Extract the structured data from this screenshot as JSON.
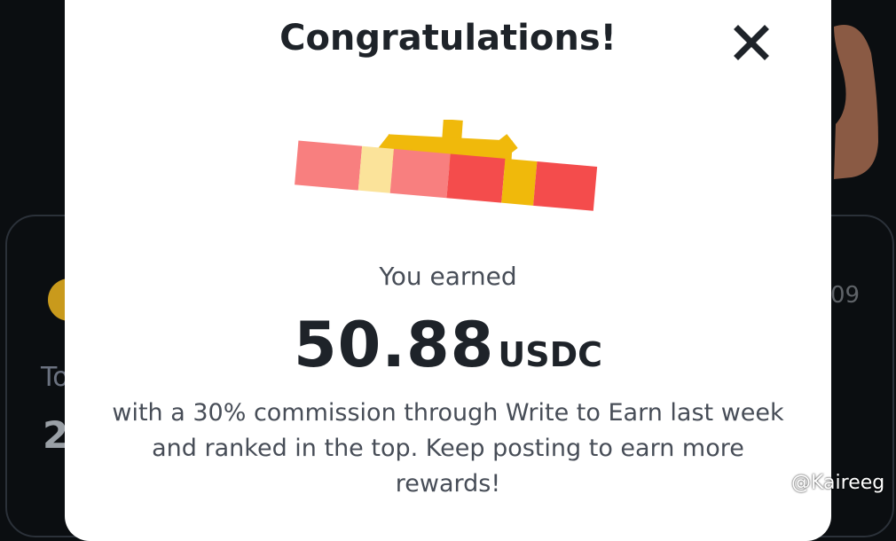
{
  "modal": {
    "title": "Congratulations!",
    "close_icon": "close-icon",
    "gift_icon": "gift-box-icon",
    "earned_label": "You earned",
    "amount": "50.88",
    "currency": "USDC",
    "message": "with a 30% commission through Write to Earn last week and ranked in the top. Keep posting to earn more rewards!"
  },
  "background": {
    "text_left_partial": "To",
    "number_left_partial": "2",
    "text_right_partial": "09"
  },
  "watermark": {
    "text": "@Kaireeg",
    "logo_icon": "binance-logo-icon"
  },
  "colors": {
    "modal_bg": "#ffffff",
    "page_bg": "#0b0e11",
    "title": "#1e2329",
    "body_text": "#474d57",
    "gift_gold": "#f0b90b",
    "gift_red": "#f6465d"
  }
}
